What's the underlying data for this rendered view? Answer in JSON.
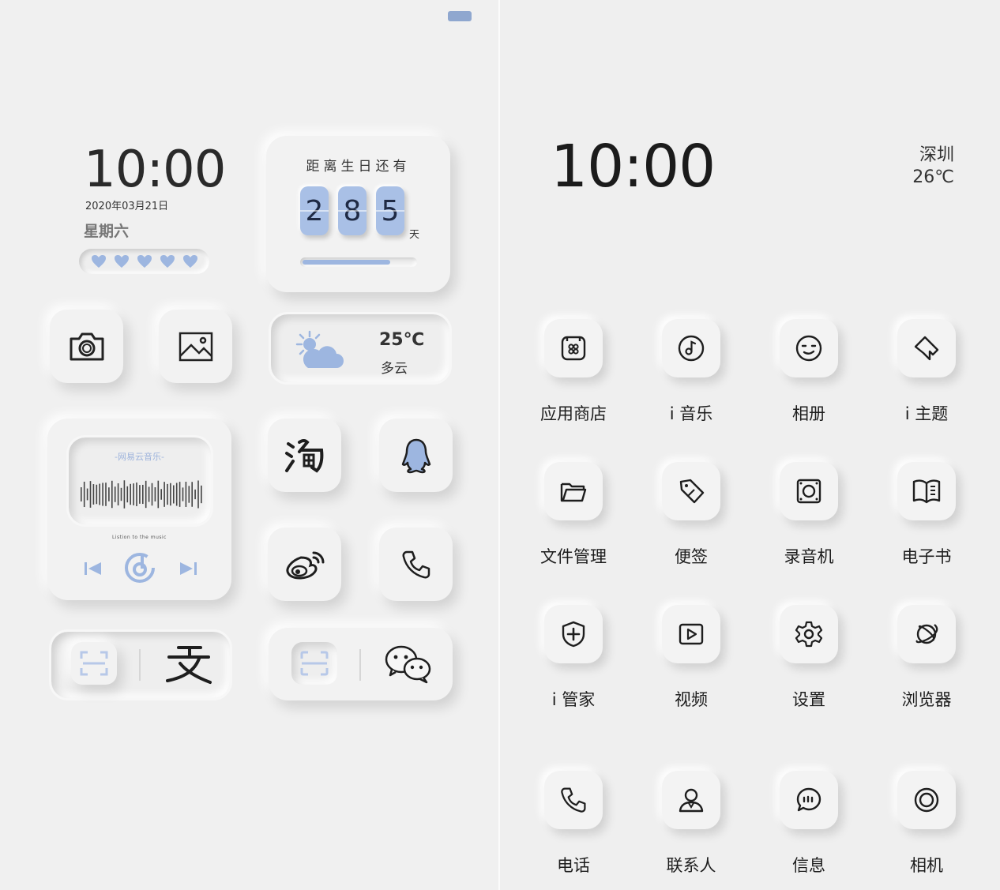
{
  "left_screen": {
    "clock_widget": {
      "time": "10:00",
      "date": "2020年03月21日",
      "weekday": "星期六",
      "hearts": 5
    },
    "birthday_widget": {
      "title": "距离生日还有",
      "digits": [
        "2",
        "8",
        "5"
      ],
      "unit": "天",
      "progress": 0.78
    },
    "weather_widget": {
      "temperature": "25℃",
      "condition": "多云",
      "icon": "partly-cloudy-icon"
    },
    "music_widget": {
      "brand": "-网易云音乐-",
      "subtitle": "Listion to the music",
      "icons": [
        "previous-icon",
        "netease-music-icon",
        "next-icon"
      ]
    },
    "apps": [
      {
        "name": "camera",
        "icon": "camera-icon"
      },
      {
        "name": "gallery",
        "icon": "image-icon"
      },
      {
        "name": "taobao",
        "icon": "taobao-icon"
      },
      {
        "name": "qq",
        "icon": "qq-penguin-icon"
      },
      {
        "name": "weibo",
        "icon": "weibo-icon"
      },
      {
        "name": "phone",
        "icon": "phone-icon"
      }
    ],
    "bottom_widgets": [
      {
        "icons": [
          "scan-icon",
          "alipay-icon"
        ]
      },
      {
        "icons": [
          "wechat-scan-icon",
          "wechat-icon"
        ]
      }
    ],
    "accent_color": "#9db6e0"
  },
  "right_screen": {
    "clock": "10:00",
    "city": "深圳",
    "temperature": "26℃",
    "apps": [
      {
        "label": "应用商店",
        "icon": "app-store-icon"
      },
      {
        "label": "i 音乐",
        "icon": "music-note-icon"
      },
      {
        "label": "相册",
        "icon": "album-face-icon"
      },
      {
        "label": "i 主题",
        "icon": "theme-brush-icon"
      },
      {
        "label": "文件管理",
        "icon": "folder-icon"
      },
      {
        "label": "便签",
        "icon": "tag-note-icon"
      },
      {
        "label": "录音机",
        "icon": "recorder-icon"
      },
      {
        "label": "电子书",
        "icon": "book-icon"
      },
      {
        "label": "i 管家",
        "icon": "shield-plus-icon"
      },
      {
        "label": "视频",
        "icon": "video-play-icon"
      },
      {
        "label": "设置",
        "icon": "gear-icon"
      },
      {
        "label": "浏览器",
        "icon": "planet-icon"
      },
      {
        "label": "电话",
        "icon": "phone-icon"
      },
      {
        "label": "联系人",
        "icon": "contact-icon"
      },
      {
        "label": "信息",
        "icon": "message-icon"
      },
      {
        "label": "相机",
        "icon": "camera-lens-icon"
      }
    ]
  }
}
